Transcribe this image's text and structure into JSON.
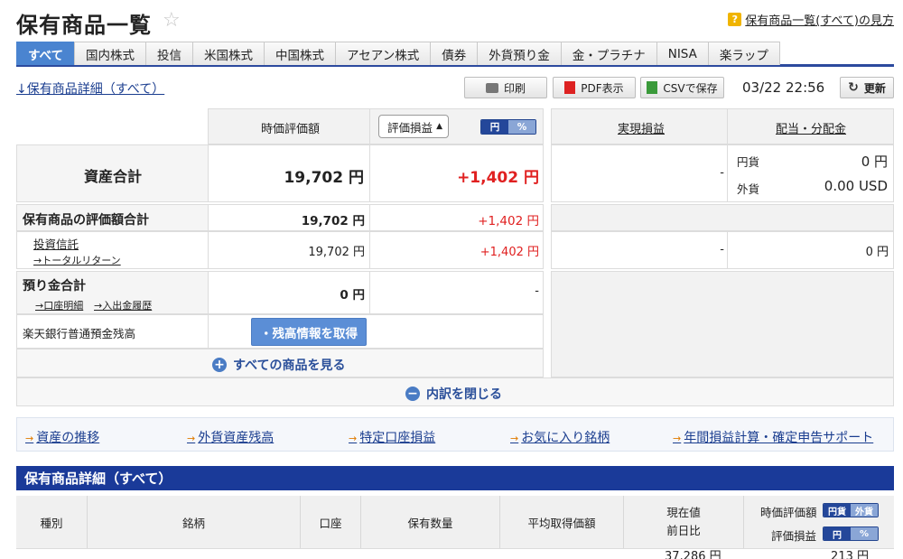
{
  "header": {
    "title": "保有商品一覧",
    "star_icon": "star-icon",
    "help_link": "保有商品一覧(すべて)の見方"
  },
  "tabs": [
    {
      "label": "すべて",
      "active": true
    },
    {
      "label": "国内株式"
    },
    {
      "label": "投信"
    },
    {
      "label": "米国株式"
    },
    {
      "label": "中国株式"
    },
    {
      "label": "アセアン株式"
    },
    {
      "label": "債券"
    },
    {
      "label": "外貨預り金"
    },
    {
      "label": "金・プラチナ"
    },
    {
      "label": "NISA"
    },
    {
      "label": "楽ラップ"
    }
  ],
  "toolbar": {
    "detail_link": "↓保有商品詳細（すべて）",
    "print_label": "印刷",
    "pdf_label": "PDF表示",
    "csv_label": "CSVで保存",
    "timestamp": "03/22 22:56",
    "refresh_label": "更新"
  },
  "summary": {
    "col_market_value": "時価評価額",
    "select_value": "評価損益",
    "toggle_yen": "円",
    "toggle_pct": "%",
    "col_realized": "実現損益",
    "col_dividend": "配当・分配金",
    "total_assets_label": "資産合計",
    "total_assets_value": "19,702 円",
    "total_assets_gain": "+1,402 円",
    "realized_dash": "-",
    "div_jpy_label": "円貨",
    "div_jpy_value": "0 円",
    "div_fx_label": "外貨",
    "div_fx_value": "0.00 USD",
    "holdings_total_label": "保有商品の評価額合計",
    "holdings_total_value": "19,702 円",
    "holdings_total_gain": "+1,402 円",
    "trust_label": "投資信託",
    "trust_sub_link": "→トータルリターン",
    "trust_value": "19,702 円",
    "trust_gain": "+1,402 円",
    "trust_realized": "-",
    "trust_dividend": "0 円",
    "deposit_label": "預り金合計",
    "deposit_link1": "→口座明細",
    "deposit_link2": "→入出金履歴",
    "deposit_value": "0 円",
    "deposit_gain": "-",
    "bank_label": "楽天銀行普通預金残高",
    "fetch_button": "・残高情報を取得",
    "see_all": "すべての商品を見る",
    "close_breakdown": "内訳を閉じる"
  },
  "links": [
    "資産の推移",
    "外貨資産残高",
    "特定口座損益",
    "お気に入り銘柄",
    "年間損益計算・確定申告サポート"
  ],
  "detail": {
    "title": "保有商品詳細（すべて）",
    "columns": [
      "種別",
      "銘柄",
      "口座",
      "保有数量",
      "平均取得価額"
    ],
    "col_price": "現在値",
    "col_change": "前日比",
    "col_mv_label": "時価評価額",
    "col_mv_opt1": "円貨",
    "col_mv_opt2": "外貨",
    "col_gain_label": "評価損益",
    "col_gain_opt1": "円",
    "col_gain_opt2": "%",
    "row_partial_price": "37,286 円",
    "row_partial_value": "213 円"
  }
}
